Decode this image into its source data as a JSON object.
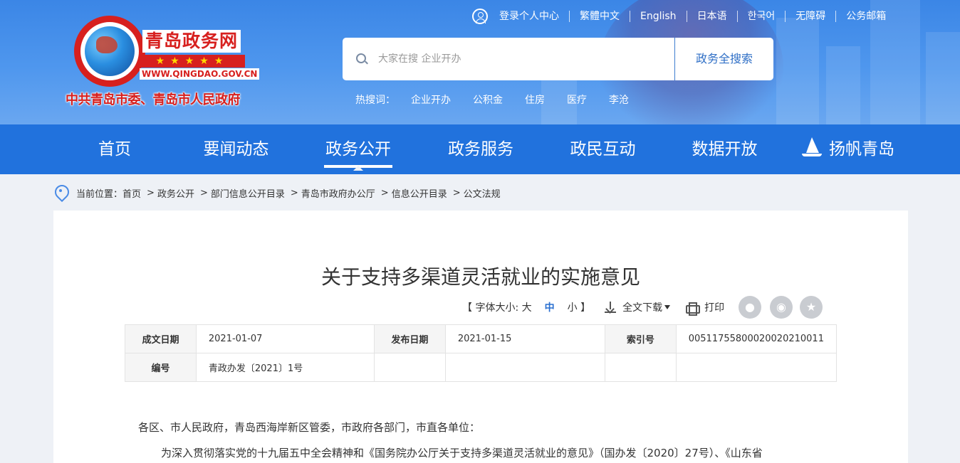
{
  "header": {
    "logo": {
      "title": "青岛政务网",
      "stars": "★★★★★",
      "domain": "WWW.QINGDAO.GOV.CN",
      "subtitle": "中共青岛市委、青岛市人民政府"
    },
    "toplinks": [
      "登录个人中心",
      "繁體中文",
      "English",
      "日本语",
      "한국어",
      "无障碍",
      "公务邮箱"
    ],
    "search": {
      "placeholder": "大家在搜 企业开办",
      "button": "政务全搜索"
    },
    "hot": {
      "label": "热搜词：",
      "items": [
        "企业开办",
        "公积金",
        "住房",
        "医疗",
        "李沧"
      ]
    }
  },
  "nav": {
    "items": [
      "首页",
      "要闻动态",
      "政务公开",
      "政务服务",
      "政民互动",
      "数据开放",
      "扬帆青岛"
    ],
    "active_index": 2
  },
  "breadcrumb": {
    "label": "当前位置：",
    "items": [
      "首页",
      "政务公开",
      "部门信息公开目录",
      "青岛市政府办公厅",
      "信息公开目录",
      "公文法规"
    ],
    "separator": ">"
  },
  "article": {
    "title": "关于支持多渠道灵活就业的实施意见",
    "tools": {
      "font_size_label": "【 字体大小: 大",
      "font_medium": "中",
      "font_small": "小 】",
      "download": "全文下载",
      "print": "打印"
    },
    "share_icons": [
      "wechat-icon",
      "weibo-icon",
      "favorite-icon"
    ],
    "meta": {
      "written_date_label": "成文日期",
      "written_date": "2021-01-07",
      "publish_date_label": "发布日期",
      "publish_date": "2021-01-15",
      "index_label": "索引号",
      "index": "00511755800020020210011",
      "number_label": "编号",
      "number": "青政办发〔2021〕1号"
    },
    "greeting": "各区、市人民政府，青岛西海岸新区管委，市政府各部门，市直各单位：",
    "first_line": "为深入贯彻落实党的十九届五中全会精神和《国务院办公厅关于支持多渠道灵活就业的意见》（国办发〔2020〕27号）、《山东省"
  },
  "colors": {
    "header_blue": "#3b86e6",
    "nav_blue": "#2172dd",
    "brand_red": "#d7201e",
    "link_blue": "#2a6fd0"
  }
}
